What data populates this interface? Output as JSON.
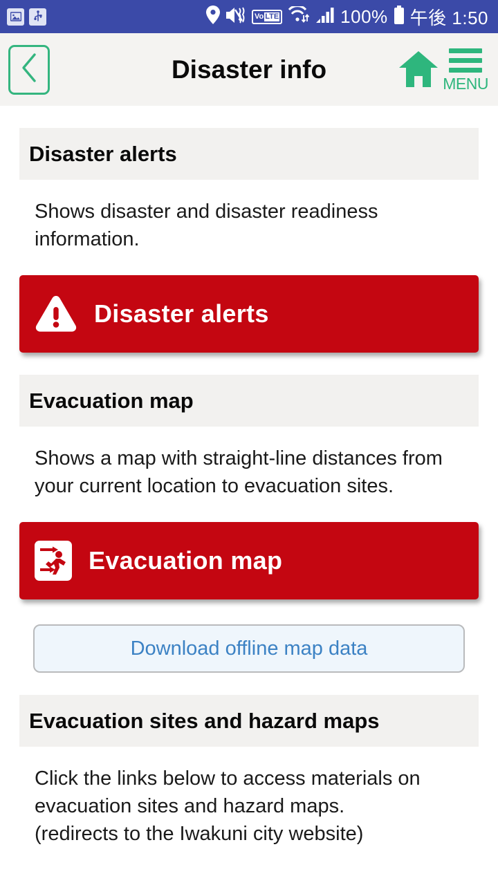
{
  "status_bar": {
    "left_icons": [
      "image-icon",
      "usb-icon"
    ],
    "right_icons": [
      "location-pin-icon",
      "volume-mute-vibrate-icon",
      "volte-icon",
      "wifi-icon",
      "signal-bars-icon",
      "battery-icon"
    ],
    "volte_label_prefix": "Vo",
    "volte_label_suffix": "LTE",
    "battery_percent": "100%",
    "time": "午後 1:50",
    "background_color": "#3b4aa8"
  },
  "header": {
    "back_label": "back",
    "title": "Disaster info",
    "home_label": "home",
    "menu_label": "MENU",
    "accent_color": "#2eb67d",
    "background_color": "#f4f3f1"
  },
  "sections": [
    {
      "id": "disaster-alerts",
      "heading": "Disaster alerts",
      "description": "Shows disaster and disaster readiness information.",
      "button": {
        "label": "Disaster alerts",
        "icon": "warning-triangle-icon",
        "color": "#c40611"
      }
    },
    {
      "id": "evacuation-map",
      "heading": "Evacuation map",
      "description": "Shows a map with straight-line distances from your current location to evacuation sites.",
      "button": {
        "label": "Evacuation map",
        "icon": "emergency-exit-running-person-icon",
        "color": "#c40611"
      },
      "secondary_button": {
        "label": "Download offline map data",
        "text_color": "#3c82c4",
        "background_color": "#eff6fc"
      }
    },
    {
      "id": "evacuation-sites-hazard-maps",
      "heading": "Evacuation sites and hazard maps",
      "description_line1": "Click the links below to access materials on evacuation sites and hazard maps.",
      "description_line2": "(redirects to the Iwakuni city website)"
    }
  ]
}
